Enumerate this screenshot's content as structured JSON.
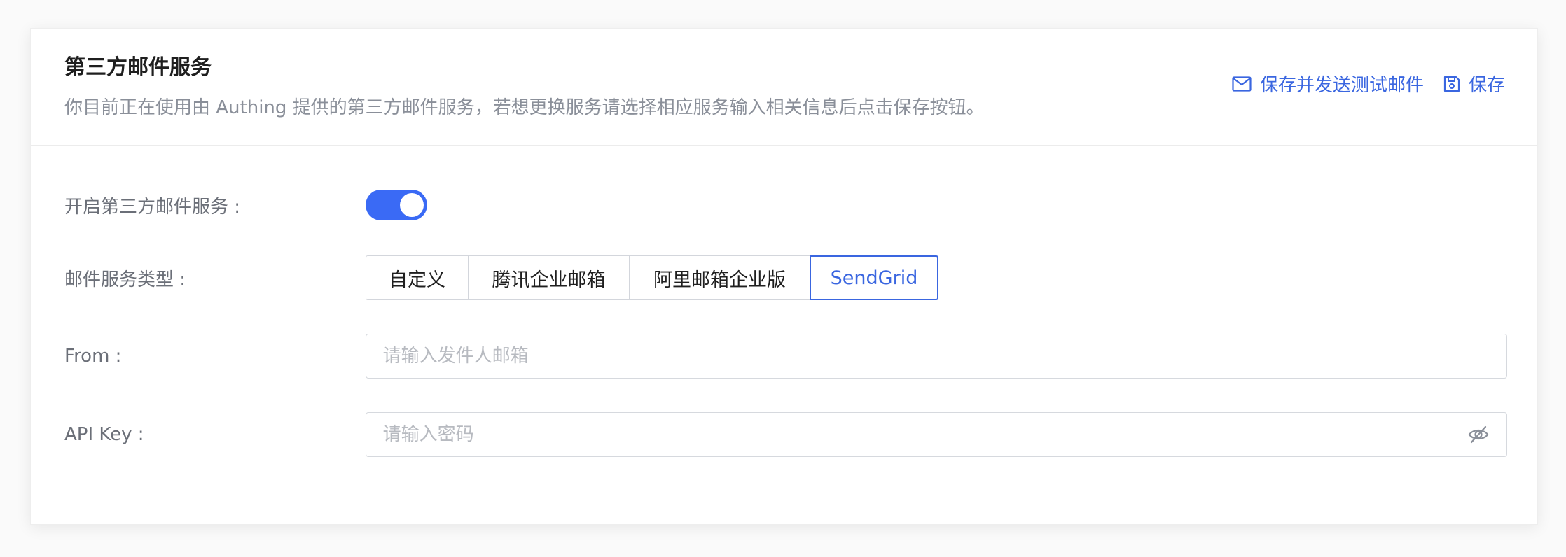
{
  "header": {
    "title": "第三方邮件服务",
    "description": "你目前正在使用由 Authing 提供的第三方邮件服务，若想更换服务请选择相应服务输入相关信息后点击保存按钮。",
    "save_and_test_label": "保存并发送测试邮件",
    "save_label": "保存"
  },
  "form": {
    "enable": {
      "label": "开启第三方邮件服务 :",
      "enabled": true
    },
    "service_type": {
      "label": "邮件服务类型 :",
      "options": [
        "自定义",
        "腾讯企业邮箱",
        "阿里邮箱企业版",
        "SendGrid"
      ],
      "selected": "SendGrid"
    },
    "from": {
      "label": "From :",
      "placeholder": "请输入发件人邮箱",
      "value": ""
    },
    "api_key": {
      "label": "API Key :",
      "placeholder": "请输入密码",
      "value": ""
    }
  },
  "colors": {
    "accent": "#3a66e0",
    "toggle_on": "#3a6af5"
  },
  "icons": {
    "save_and_test": "mail-icon",
    "save": "floppy-disk-icon",
    "password_visibility": "eye-off-icon"
  }
}
